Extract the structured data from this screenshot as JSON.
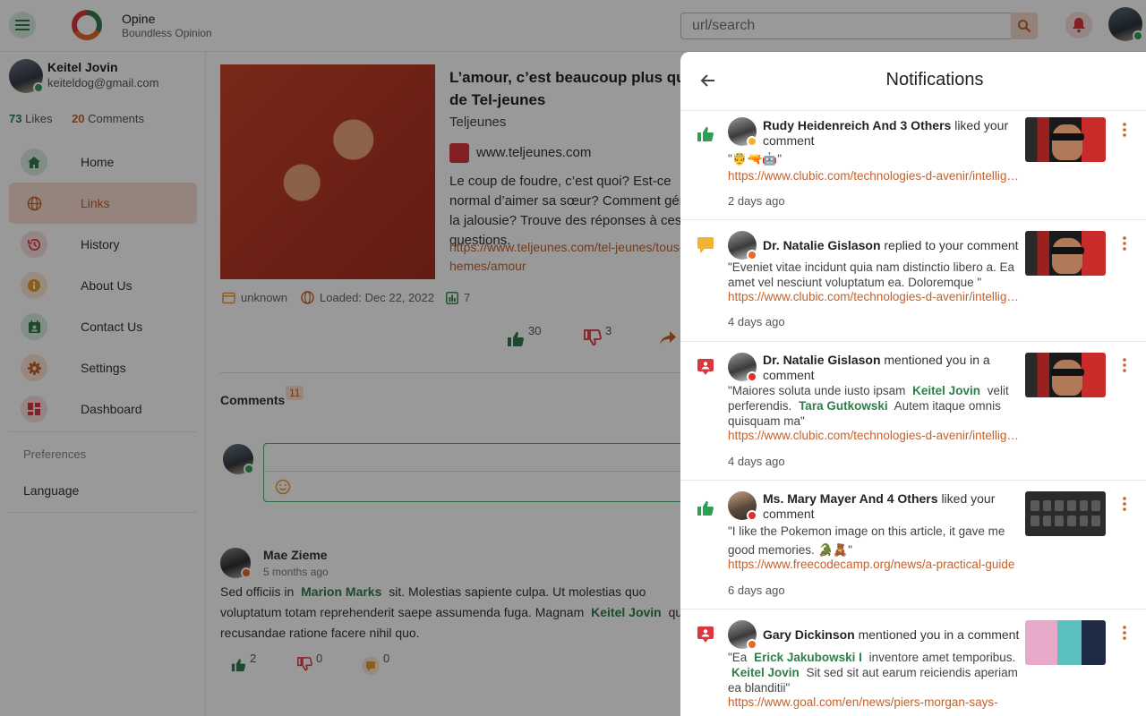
{
  "app": {
    "title": "Opine",
    "subtitle": "Boundless Opinion"
  },
  "search": {
    "placeholder": "url/search"
  },
  "user": {
    "name": "Keitel Jovin",
    "email": "keiteldog@gmail.com",
    "likes": "73",
    "likes_label": "Likes",
    "comments": "20",
    "comments_label": "Comments"
  },
  "sidebar": {
    "items": [
      {
        "label": "Home",
        "icon": "home-icon",
        "color": "#2e7d4a"
      },
      {
        "label": "Links",
        "icon": "globe-icon",
        "color": "#c2622a",
        "active": true
      },
      {
        "label": "History",
        "icon": "history-icon",
        "color": "#d9363e"
      },
      {
        "label": "About Us",
        "icon": "info-icon",
        "color": "#e89a2c"
      },
      {
        "label": "Contact Us",
        "icon": "calendar-contact-icon",
        "color": "#2e7d4a"
      },
      {
        "label": "Settings",
        "icon": "gear-icon",
        "color": "#c2622a"
      },
      {
        "label": "Dashboard",
        "icon": "dashboard-icon",
        "color": "#d9363e"
      }
    ],
    "preferences": "Preferences",
    "language": "Language"
  },
  "article": {
    "title": "L’amour, c’est beaucoup plus que de Tel-jeunes",
    "source": "Teljeunes",
    "site": "www.teljeunes.com",
    "description": "Le coup de foudre, c’est quoi? Est-ce normal d’aimer sa sœur? Comment gérer la jalousie? Trouve des réponses à ces questions.",
    "link": "https://www.teljeunes.com/tel-jeunes/tous-les-themes/amour",
    "date": "unknown",
    "loaded": "Loaded: Dec 22, 2022",
    "views": "7",
    "likes": "30",
    "dislikes": "3"
  },
  "comments": {
    "title": "Comments",
    "count": "11",
    "items": [
      {
        "author": "Mae Zieme",
        "time": "5 months ago",
        "text_1": "Sed officiis in",
        "mention_1": "Marion Marks",
        "text_2": "sit. Molestias sapiente culpa. Ut molestias quo voluptatum totam reprehenderit saepe assumenda fuga. Magnam",
        "mention_2": "Keitel Jovin",
        "text_3": "quo recusandae ratione facere nihil quo.",
        "likes": "2",
        "dislikes": "0",
        "replies": "0"
      }
    ]
  },
  "notifications": {
    "title": "Notifications",
    "items": [
      {
        "type_icon": "thumbs-up-icon",
        "actor": "Rudy Heidenreich And 3 Others",
        "action": "liked your comment",
        "quote": "\"🤴🔫🤖\"",
        "link": "https://www.clubic.com/technologies-d-avenir/intelligence-artificielle",
        "time": "2 days ago",
        "status_color": "#f2b233"
      },
      {
        "type_icon": "comment-icon",
        "actor": "Dr. Natalie Gislason",
        "action": "replied to your comment",
        "quote": "\"Eveniet vitae incidunt quia nam distinctio libero a. Ea amet vel nesciunt voluptatum ea. Doloremque \"",
        "link": "https://www.clubic.com/technologies-d-avenir/intelligence-artificielle",
        "time": "4 days ago",
        "status_color": "#e8672c"
      },
      {
        "type_icon": "mention-icon",
        "actor": "Dr. Natalie Gislason",
        "action": "mentioned you in a comment",
        "quote_1": "\"Maiores soluta unde iusto ipsam",
        "mention_1": "Keitel Jovin",
        "quote_2": "velit perferendis.",
        "mention_2": "Tara Gutkowski",
        "quote_3": "Autem itaque omnis quisquam ma\"",
        "link": "https://www.clubic.com/technologies-d-avenir/intelligence-artificielle",
        "time": "4 days ago",
        "status_color": "#e02d2d"
      },
      {
        "type_icon": "thumbs-up-icon",
        "actor": "Ms. Mary Mayer And 4 Others",
        "action": "liked your comment",
        "quote": "\"I like the Pokemon image on this article, it gave me good memories. 🐊🧸\"",
        "link": "https://www.freecodecamp.org/news/a-practical-guide",
        "time": "6 days ago",
        "status_color": "#e02d2d"
      },
      {
        "type_icon": "mention-icon",
        "actor": "Gary Dickinson",
        "action": "mentioned you in a comment",
        "quote_1": "\"Ea",
        "mention_1": "Erick Jakubowski I",
        "quote_2": "inventore amet temporibus.",
        "mention_2": "Keitel Jovin",
        "quote_3": "Sit sed sit aut earum reiciendis aperiam ea blanditii\"",
        "link": "https://www.goal.com/en/news/piers-morgan-says-",
        "time": "",
        "status_color": "#e8672c"
      }
    ]
  },
  "colors": {
    "accent": "#c2622a",
    "green": "#2e7d4a",
    "red": "#d9363e"
  }
}
